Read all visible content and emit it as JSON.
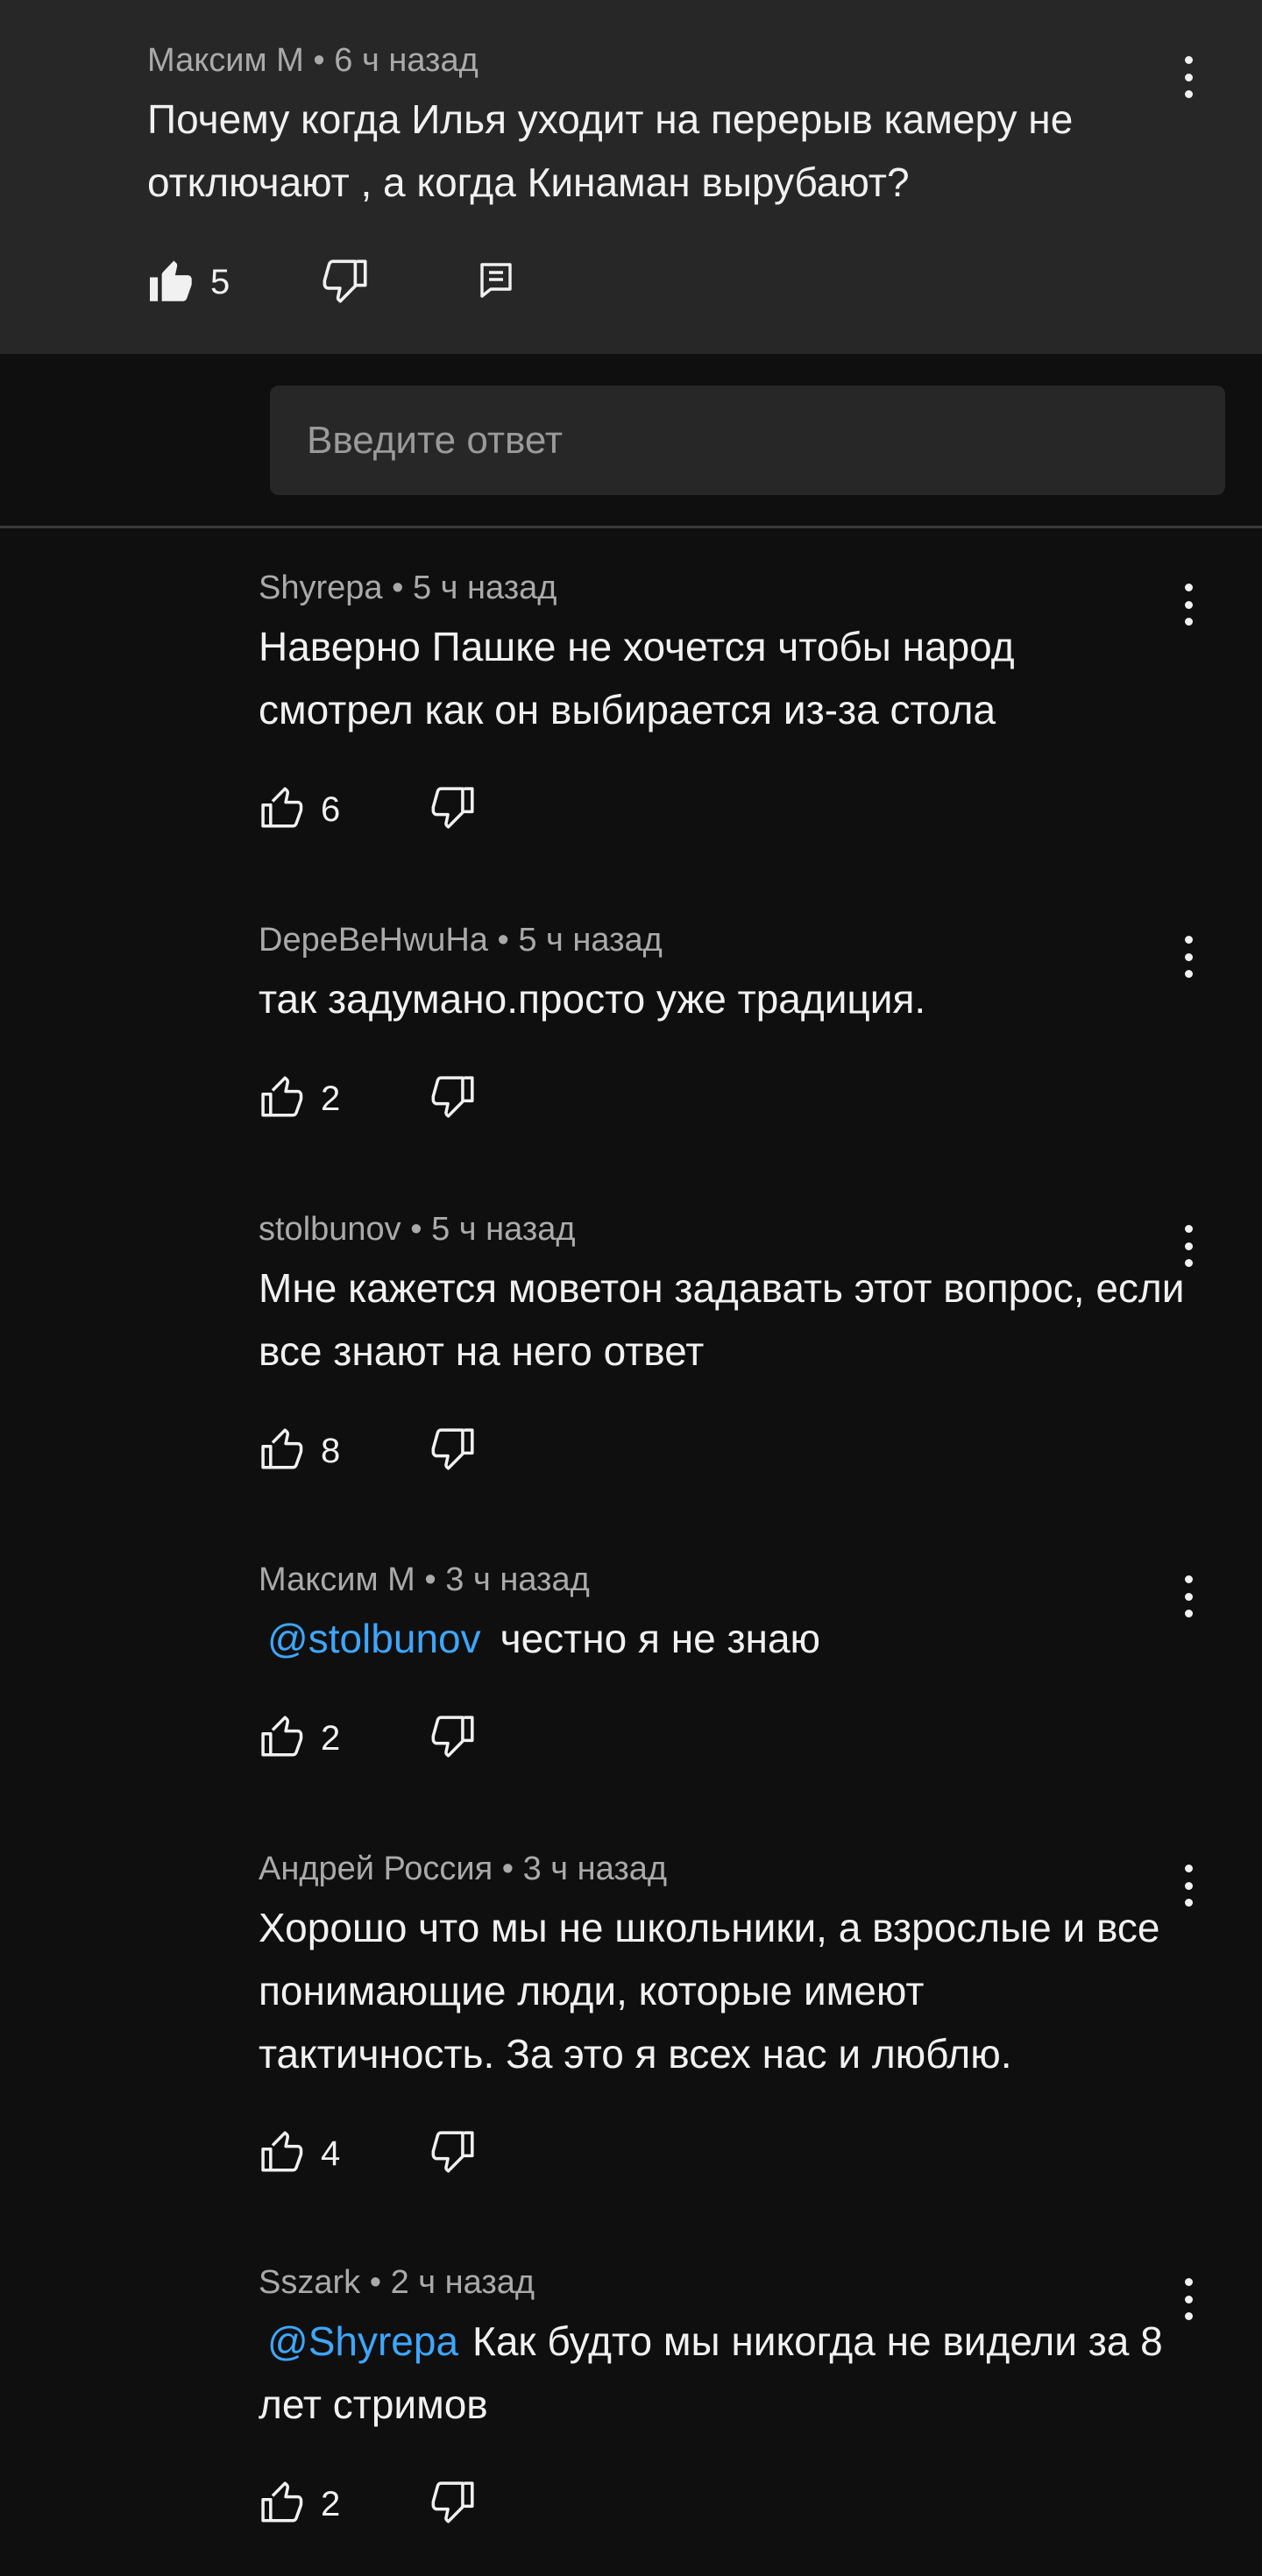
{
  "parent": {
    "author": "Максим М",
    "time": "6 ч назад",
    "text": "Почему когда Илья уходит на перерыв камеру не отключают , а когда Кинаман вырубают?",
    "likes": "5"
  },
  "reply_input": {
    "placeholder": "Введите ответ"
  },
  "separator": "•",
  "replies": [
    {
      "author": "Shyrepa",
      "time": "5 ч назад",
      "mention": "",
      "text": "Наверно Пашке не хочется чтобы народ смотрел как он выбирается из-за стола",
      "likes": "6"
    },
    {
      "author": "DepeBeHwuHa",
      "time": "5 ч назад",
      "mention": "",
      "text": "так задумано.просто уже традиция.",
      "likes": "2"
    },
    {
      "author": "stolbunov",
      "time": "5 ч назад",
      "mention": "",
      "text": "Мне кажется моветон задавать этот вопрос, если все знают на него ответ",
      "likes": "8"
    },
    {
      "author": "Максим М",
      "time": "3 ч назад",
      "mention": "@stolbunov",
      "text": "честно я не знаю",
      "likes": "2"
    },
    {
      "author": "Андрей Россия",
      "time": "3 ч назад",
      "mention": "",
      "text": "Хорошо что мы не школьники, а взрослые и все понимающие люди, которые имеют тактичность. За это я всех нас и люблю.",
      "likes": "4"
    },
    {
      "author": "Sszark",
      "time": "2 ч назад",
      "mention": "@Shyrepa",
      "text": "Как будто мы никогда не видели за 8 лет стримов",
      "likes": "2"
    }
  ]
}
